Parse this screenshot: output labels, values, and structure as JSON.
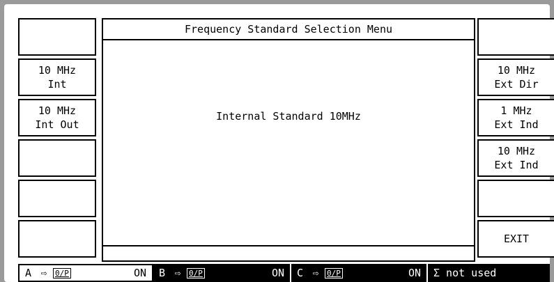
{
  "title": "Frequency Standard Selection Menu",
  "message": "Internal Standard 10MHz",
  "left_softkeys": [
    "",
    "10 MHz\nInt",
    "10 MHz\nInt Out",
    "",
    "",
    ""
  ],
  "right_softkeys": [
    "",
    "10 MHz\nExt Dir",
    "1 MHz\nExt Ind",
    "10 MHz\nExt Ind",
    "",
    "EXIT"
  ],
  "status": {
    "a": {
      "channel": "A",
      "arrow": "⇨",
      "label": "0/P",
      "state": "ON"
    },
    "b": {
      "channel": "B",
      "arrow": "⇨",
      "label": "0/P",
      "state": "ON"
    },
    "c": {
      "channel": "C",
      "arrow": "⇨",
      "label": "0/P",
      "state": "ON"
    },
    "sigma": "Σ not used"
  }
}
